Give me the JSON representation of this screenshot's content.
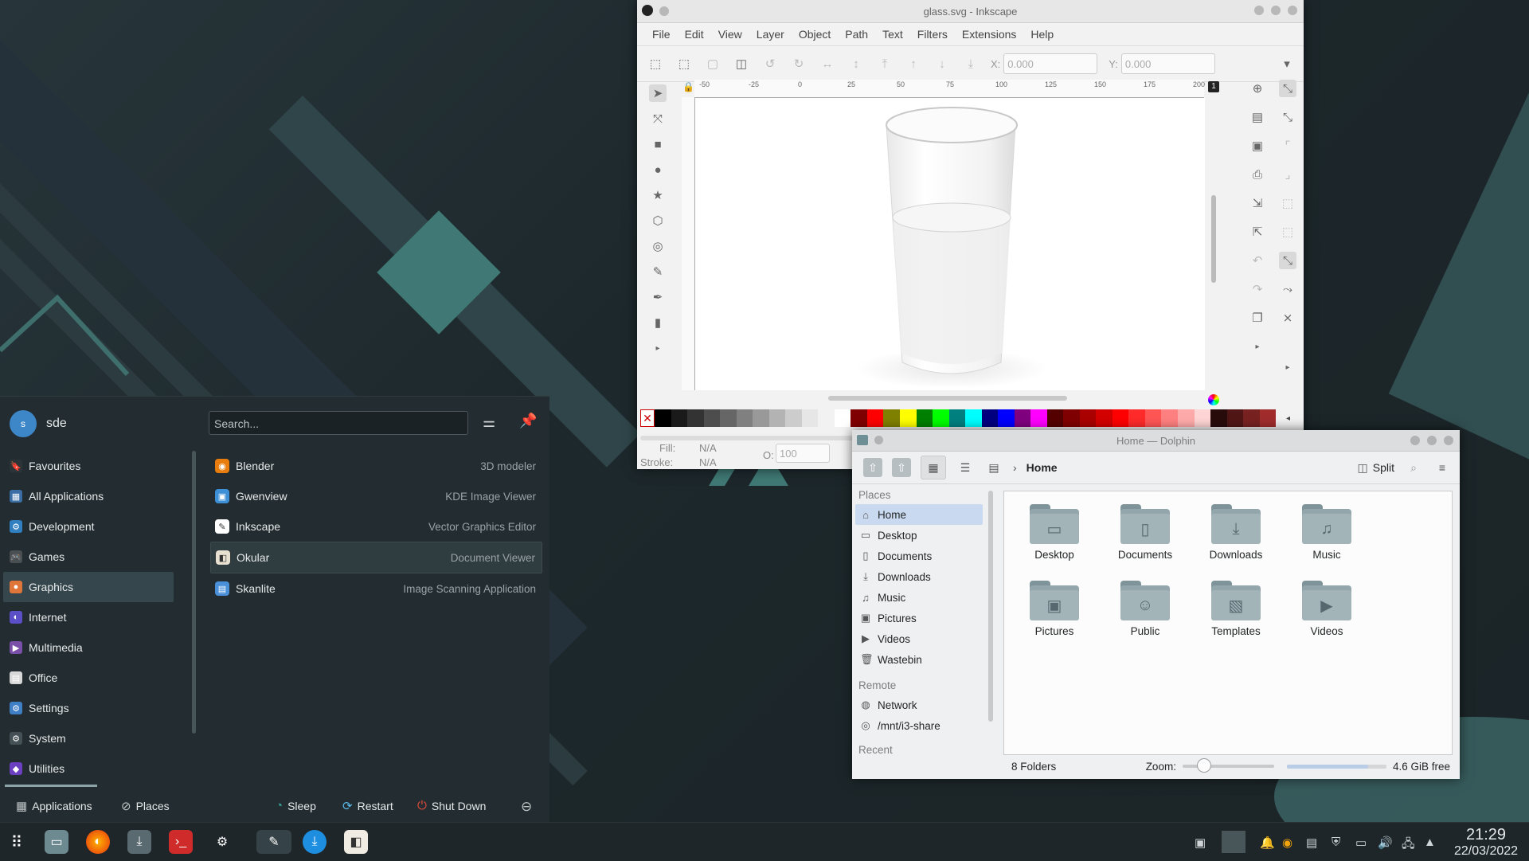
{
  "inkscape": {
    "title": "glass.svg - Inkscape",
    "menu": [
      "File",
      "Edit",
      "View",
      "Layer",
      "Object",
      "Path",
      "Text",
      "Filters",
      "Extensions",
      "Help"
    ],
    "x_label": "X:",
    "x_value": "0.000",
    "y_label": "Y:",
    "y_value": "0.000",
    "ruler_ticks": [
      "-50",
      "-25",
      "0",
      "25",
      "50",
      "75",
      "100",
      "125",
      "150",
      "175",
      "200"
    ],
    "layer_badge": "1",
    "fill_label": "Fill:",
    "fill_value": "N/A",
    "stroke_label": "Stroke:",
    "stroke_value": "N/A",
    "opacity_label": "O:",
    "opacity_value": "100",
    "palette": [
      "#000000",
      "#1a1a1a",
      "#333333",
      "#4d4d4d",
      "#666666",
      "#808080",
      "#999999",
      "#b3b3b3",
      "#cccccc",
      "#e6e6e6",
      "#f2f2f2",
      "#ffffff",
      "#800000",
      "#ff0000",
      "#808000",
      "#ffff00",
      "#008000",
      "#00ff00",
      "#008080",
      "#00ffff",
      "#000080",
      "#0000ff",
      "#800080",
      "#ff00ff",
      "#550000",
      "#800000",
      "#aa0000",
      "#d40000",
      "#ff0000",
      "#ff2a2a",
      "#ff5555",
      "#ff8080",
      "#ffaaaa",
      "#ffd5d5",
      "#280b0b",
      "#501616",
      "#782121",
      "#a02c2c"
    ]
  },
  "dolphin": {
    "title": "Home — Dolphin",
    "breadcrumb": "Home",
    "split_label": "Split",
    "places_header": "Places",
    "places": [
      {
        "label": "Home",
        "icon": "⌂"
      },
      {
        "label": "Desktop",
        "icon": "▭"
      },
      {
        "label": "Documents",
        "icon": "▯"
      },
      {
        "label": "Downloads",
        "icon": "⤓"
      },
      {
        "label": "Music",
        "icon": "♫"
      },
      {
        "label": "Pictures",
        "icon": "▣"
      },
      {
        "label": "Videos",
        "icon": "▶"
      },
      {
        "label": "Wastebin",
        "icon": "🗑"
      }
    ],
    "remote_header": "Remote",
    "remote": [
      {
        "label": "Network",
        "icon": "◍"
      },
      {
        "label": "/mnt/i3-share",
        "icon": "◎"
      }
    ],
    "recent_header": "Recent",
    "folders": [
      {
        "label": "Desktop",
        "glyph": "▭"
      },
      {
        "label": "Documents",
        "glyph": "▯"
      },
      {
        "label": "Downloads",
        "glyph": "⤓"
      },
      {
        "label": "Music",
        "glyph": "♫"
      },
      {
        "label": "Pictures",
        "glyph": "▣"
      },
      {
        "label": "Public",
        "glyph": "☺"
      },
      {
        "label": "Templates",
        "glyph": "▧"
      },
      {
        "label": "Videos",
        "glyph": "▶"
      }
    ],
    "status_count": "8 Folders",
    "zoom_label": "Zoom:",
    "free_space": "4.6 GiB free",
    "free_fraction": 0.82
  },
  "launcher": {
    "avatar_letter": "s",
    "username": "sde",
    "search_placeholder": "Search...",
    "categories": [
      {
        "label": "Favourites",
        "color": "#2b3437",
        "glyph": "🔖"
      },
      {
        "label": "All Applications",
        "color": "#3b6ea5",
        "glyph": "▦"
      },
      {
        "label": "Development",
        "color": "#2f7fc1",
        "glyph": "⚙"
      },
      {
        "label": "Games",
        "color": "#4a4f52",
        "glyph": "🎮"
      },
      {
        "label": "Graphics",
        "color": "#e0753a",
        "glyph": "●"
      },
      {
        "label": "Internet",
        "color": "#5b4fc7",
        "glyph": "◐"
      },
      {
        "label": "Multimedia",
        "color": "#7a4fa8",
        "glyph": "▶"
      },
      {
        "label": "Office",
        "color": "#d7d7d7",
        "glyph": "▤"
      },
      {
        "label": "Settings",
        "color": "#3f7fc6",
        "glyph": "⚙"
      },
      {
        "label": "System",
        "color": "#445055",
        "glyph": "⚙"
      },
      {
        "label": "Utilities",
        "color": "#6a3fc0",
        "glyph": "◆"
      }
    ],
    "selected_category": "Graphics",
    "apps": [
      {
        "name": "Blender",
        "desc": "3D modeler",
        "color": "#e87d0d",
        "glyph": "◉"
      },
      {
        "name": "Gwenview",
        "desc": "KDE Image Viewer",
        "color": "#3d8fd6",
        "glyph": "▣"
      },
      {
        "name": "Inkscape",
        "desc": "Vector Graphics Editor",
        "color": "#ffffff",
        "glyph": "✎"
      },
      {
        "name": "Okular",
        "desc": "Document Viewer",
        "color": "#e8e1d2",
        "glyph": "◧"
      },
      {
        "name": "Skanlite",
        "desc": "Image Scanning Application",
        "color": "#4a90d9",
        "glyph": "▤"
      }
    ],
    "footer": {
      "applications": "Applications",
      "places": "Places",
      "sleep": "Sleep",
      "restart": "Restart",
      "shutdown": "Shut Down"
    }
  },
  "taskbar": {
    "time": "21:29",
    "date": "22/03/2022"
  }
}
